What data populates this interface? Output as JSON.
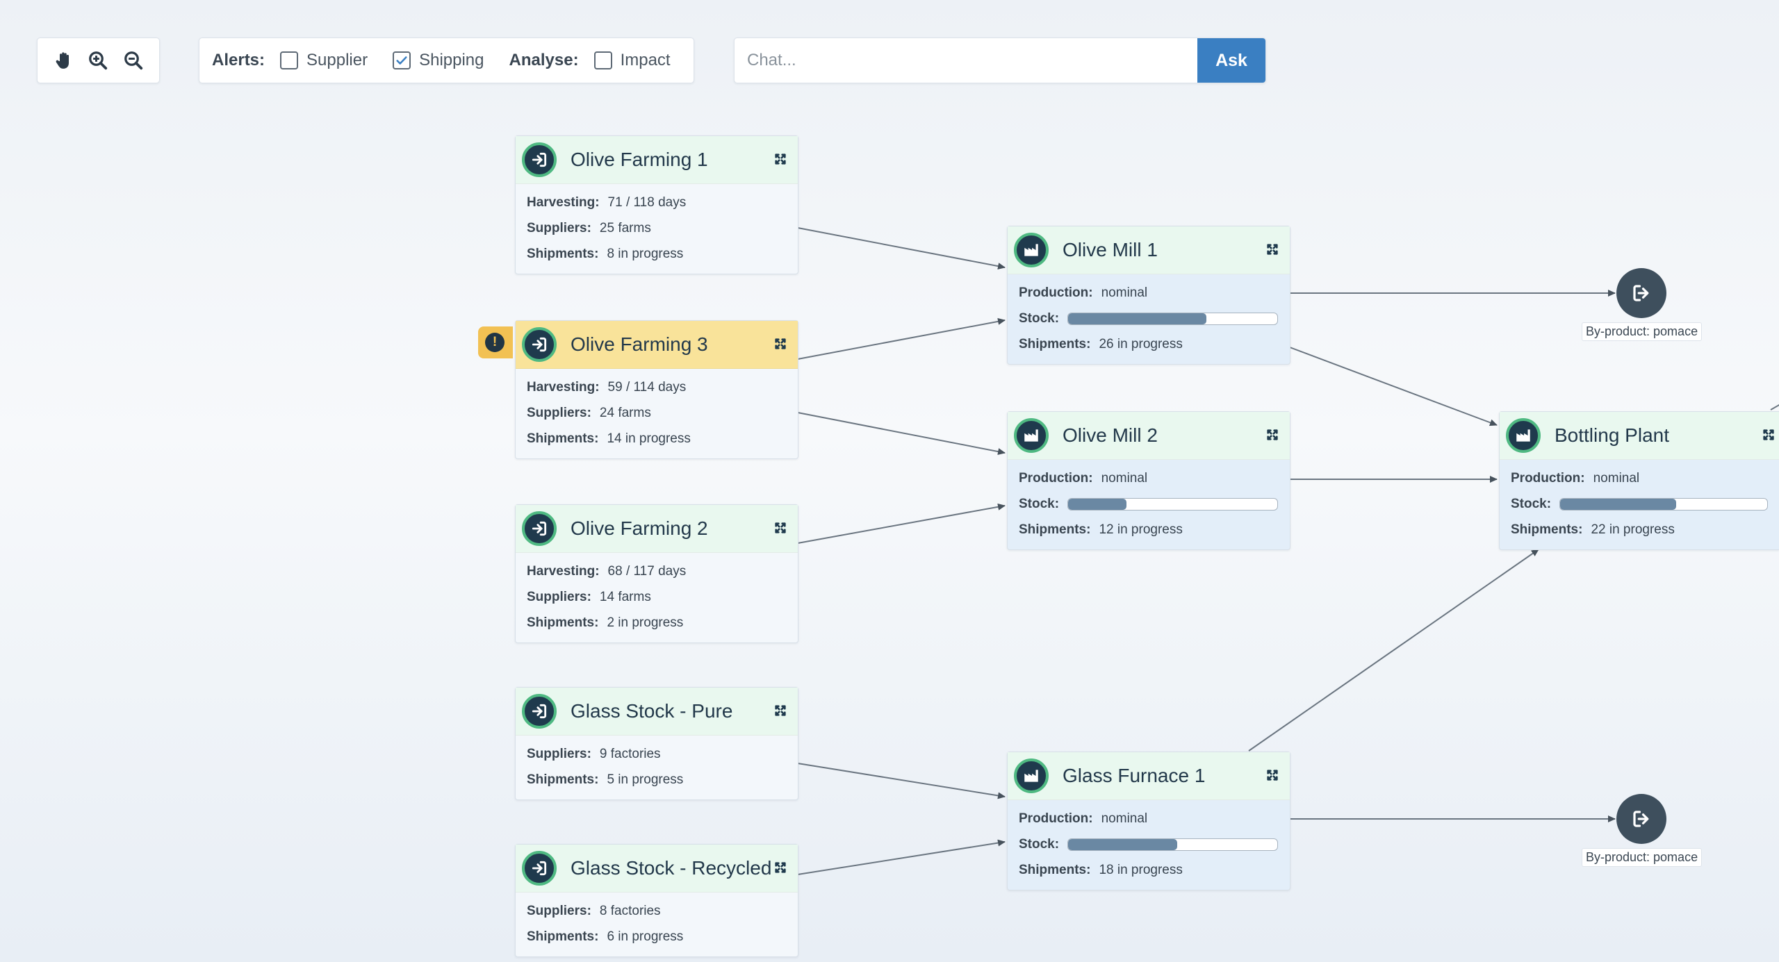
{
  "toolbar": {
    "tools": [
      "hand-icon",
      "zoom-in-icon",
      "zoom-out-icon"
    ]
  },
  "filters": {
    "alerts_label": "Alerts:",
    "supplier": {
      "label": "Supplier",
      "checked": false
    },
    "shipping": {
      "label": "Shipping",
      "checked": true
    },
    "analyse_label": "Analyse:",
    "impact": {
      "label": "Impact",
      "checked": false
    }
  },
  "chat": {
    "placeholder": "Chat...",
    "ask_label": "Ask"
  },
  "colors": {
    "accent": "#3a7fc2",
    "alert": "#f9e39a",
    "source_header": "#e9f8ef",
    "icon_ring": "#4fb982",
    "icon_fill": "#1f3a4d"
  },
  "nodes": {
    "farming1": {
      "title": "Olive Farming 1",
      "icon": "input-icon",
      "harvesting_k": "Harvesting:",
      "harvesting_v": "71 / 118 days",
      "suppliers_k": "Suppliers:",
      "suppliers_v": "25 farms",
      "shipments_k": "Shipments:",
      "shipments_v": "8 in progress"
    },
    "farming3": {
      "title": "Olive Farming 3",
      "icon": "input-icon",
      "alert": true,
      "alert_symbol": "!",
      "harvesting_k": "Harvesting:",
      "harvesting_v": "59 / 114 days",
      "suppliers_k": "Suppliers:",
      "suppliers_v": "24 farms",
      "shipments_k": "Shipments:",
      "shipments_v": "14 in progress"
    },
    "farming2": {
      "title": "Olive Farming 2",
      "icon": "input-icon",
      "harvesting_k": "Harvesting:",
      "harvesting_v": "68 / 117 days",
      "suppliers_k": "Suppliers:",
      "suppliers_v": "14 farms",
      "shipments_k": "Shipments:",
      "shipments_v": "2 in progress"
    },
    "glass_pure": {
      "title": "Glass Stock - Pure",
      "icon": "input-icon",
      "suppliers_k": "Suppliers:",
      "suppliers_v": "9 factories",
      "shipments_k": "Shipments:",
      "shipments_v": "5 in progress"
    },
    "glass_recycled": {
      "title": "Glass Stock - Recycled",
      "icon": "input-icon",
      "suppliers_k": "Suppliers:",
      "suppliers_v": "8 factories",
      "shipments_k": "Shipments:",
      "shipments_v": "6 in progress"
    },
    "mill1": {
      "title": "Olive Mill 1",
      "icon": "factory-icon",
      "production_k": "Production:",
      "production_v": "nominal",
      "stock_k": "Stock:",
      "stock_level": 0.66,
      "shipments_k": "Shipments:",
      "shipments_v": "26 in progress"
    },
    "mill2": {
      "title": "Olive Mill 2",
      "icon": "factory-icon",
      "production_k": "Production:",
      "production_v": "nominal",
      "stock_k": "Stock:",
      "stock_level": 0.28,
      "shipments_k": "Shipments:",
      "shipments_v": "12 in progress"
    },
    "furnace1": {
      "title": "Glass Furnace 1",
      "icon": "factory-icon",
      "production_k": "Production:",
      "production_v": "nominal",
      "stock_k": "Stock:",
      "stock_level": 0.52,
      "shipments_k": "Shipments:",
      "shipments_v": "18 in progress"
    },
    "bottling": {
      "title": "Bottling Plant",
      "icon": "factory-icon",
      "production_k": "Production:",
      "production_v": "nominal",
      "stock_k": "Stock:",
      "stock_level": 0.56,
      "shipments_k": "Shipments:",
      "shipments_v": "22 in progress"
    }
  },
  "exits": {
    "exit1": {
      "label": "By-product: pomace",
      "icon": "exit-icon"
    },
    "exit2": {
      "label": "By-product: pomace",
      "icon": "exit-icon"
    }
  }
}
